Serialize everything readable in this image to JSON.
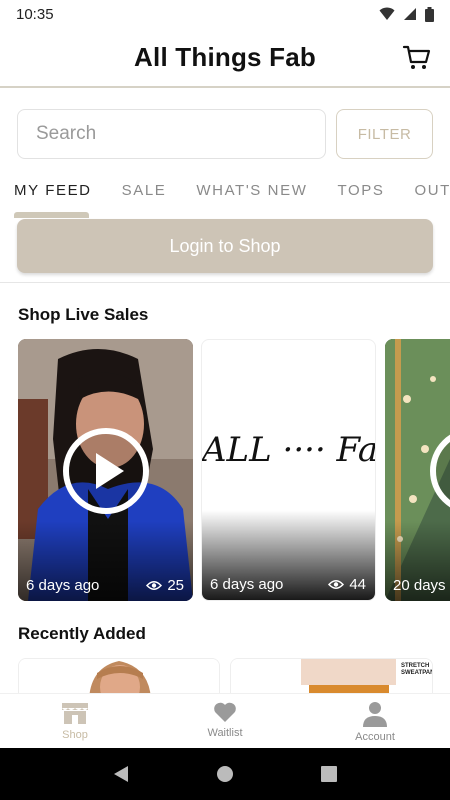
{
  "status": {
    "time": "10:35"
  },
  "header": {
    "title": "All Things Fab"
  },
  "search": {
    "placeholder": "Search",
    "filter_label": "FILTER"
  },
  "tabs": [
    "MY FEED",
    "SALE",
    "WHAT'S NEW",
    "TOPS",
    "OUTE"
  ],
  "login": {
    "label": "Login to Shop"
  },
  "live_sales": {
    "title": "Shop Live Sales",
    "cards": [
      {
        "age": "6 days ago",
        "views": "25"
      },
      {
        "age": "6 days ago",
        "views": "44",
        "image_text": "ALL ···· Fab ·it·sit"
      },
      {
        "age": "20 days"
      }
    ]
  },
  "recent": {
    "title": "Recently Added",
    "card2_tag": "STRETCH SWEATPANTS"
  },
  "nav": {
    "shop": "Shop",
    "waitlist": "Waitlist",
    "account": "Account"
  },
  "colors": {
    "accent": "#cdc4b6",
    "accent_text": "#c7bba4",
    "blue_jacket": "#1f3fc0"
  }
}
